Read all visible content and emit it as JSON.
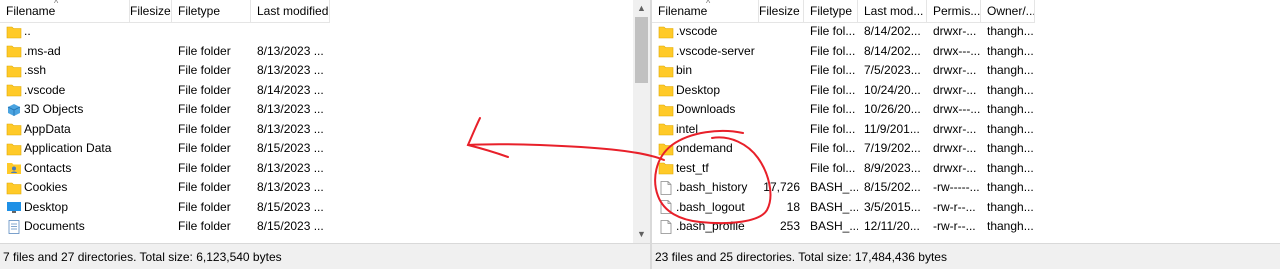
{
  "local": {
    "columns": [
      "Filename",
      "Filesize",
      "Filetype",
      "Last modified"
    ],
    "rows": [
      {
        "name": "..",
        "size": "",
        "type": "",
        "modified": "",
        "icon": "folder-icon"
      },
      {
        "name": ".ms-ad",
        "size": "",
        "type": "File folder",
        "modified": "8/13/2023 ...",
        "icon": "folder-icon"
      },
      {
        "name": ".ssh",
        "size": "",
        "type": "File folder",
        "modified": "8/13/2023 ...",
        "icon": "folder-icon"
      },
      {
        "name": ".vscode",
        "size": "",
        "type": "File folder",
        "modified": "8/14/2023 ...",
        "icon": "folder-icon"
      },
      {
        "name": "3D Objects",
        "size": "",
        "type": "File folder",
        "modified": "8/13/2023 ...",
        "icon": "3d-objects-icon"
      },
      {
        "name": "AppData",
        "size": "",
        "type": "File folder",
        "modified": "8/13/2023 ...",
        "icon": "folder-icon"
      },
      {
        "name": "Application Data",
        "size": "",
        "type": "File folder",
        "modified": "8/15/2023 ...",
        "icon": "folder-icon"
      },
      {
        "name": "Contacts",
        "size": "",
        "type": "File folder",
        "modified": "8/13/2023 ...",
        "icon": "contacts-icon"
      },
      {
        "name": "Cookies",
        "size": "",
        "type": "File folder",
        "modified": "8/13/2023 ...",
        "icon": "folder-icon"
      },
      {
        "name": "Desktop",
        "size": "",
        "type": "File folder",
        "modified": "8/15/2023 ...",
        "icon": "desktop-icon"
      },
      {
        "name": "Documents",
        "size": "",
        "type": "File folder",
        "modified": "8/15/2023 ...",
        "icon": "documents-icon"
      }
    ],
    "status": "7 files and 27 directories. Total size: 6,123,540 bytes"
  },
  "remote": {
    "columns": [
      "Filename",
      "Filesize",
      "Filetype",
      "Last mod...",
      "Permis...",
      "Owner/..."
    ],
    "rows": [
      {
        "name": ".vscode",
        "size": "",
        "type": "File fol...",
        "modified": "8/14/202...",
        "perm": "drwxr-...",
        "owner": "thangh...",
        "icon": "folder-icon"
      },
      {
        "name": ".vscode-server",
        "size": "",
        "type": "File fol...",
        "modified": "8/14/202...",
        "perm": "drwx---...",
        "owner": "thangh...",
        "icon": "folder-icon"
      },
      {
        "name": "bin",
        "size": "",
        "type": "File fol...",
        "modified": "7/5/2023...",
        "perm": "drwxr-...",
        "owner": "thangh...",
        "icon": "folder-icon"
      },
      {
        "name": "Desktop",
        "size": "",
        "type": "File fol...",
        "modified": "10/24/20...",
        "perm": "drwxr-...",
        "owner": "thangh...",
        "icon": "folder-icon"
      },
      {
        "name": "Downloads",
        "size": "",
        "type": "File fol...",
        "modified": "10/26/20...",
        "perm": "drwx---...",
        "owner": "thangh...",
        "icon": "folder-icon"
      },
      {
        "name": "intel",
        "size": "",
        "type": "File fol...",
        "modified": "11/9/201...",
        "perm": "drwxr-...",
        "owner": "thangh...",
        "icon": "folder-icon"
      },
      {
        "name": "ondemand",
        "size": "",
        "type": "File fol...",
        "modified": "7/19/202...",
        "perm": "drwxr-...",
        "owner": "thangh...",
        "icon": "folder-icon"
      },
      {
        "name": "test_tf",
        "size": "",
        "type": "File fol...",
        "modified": "8/9/2023...",
        "perm": "drwxr-...",
        "owner": "thangh...",
        "icon": "folder-icon"
      },
      {
        "name": ".bash_history",
        "size": "17,726",
        "type": "BASH_...",
        "modified": "8/15/202...",
        "perm": "-rw-----...",
        "owner": "thangh...",
        "icon": "file-icon"
      },
      {
        "name": ".bash_logout",
        "size": "18",
        "type": "BASH_...",
        "modified": "3/5/2015...",
        "perm": "-rw-r--...",
        "owner": "thangh...",
        "icon": "file-icon"
      },
      {
        "name": ".bash_profile",
        "size": "253",
        "type": "BASH_...",
        "modified": "12/11/20...",
        "perm": "-rw-r--...",
        "owner": "thangh...",
        "icon": "file-icon"
      }
    ],
    "status": "23 files and 25 directories. Total size: 17,484,436 bytes"
  },
  "colors": {
    "folder": "#ffca28",
    "annotation": "#e8202a"
  }
}
